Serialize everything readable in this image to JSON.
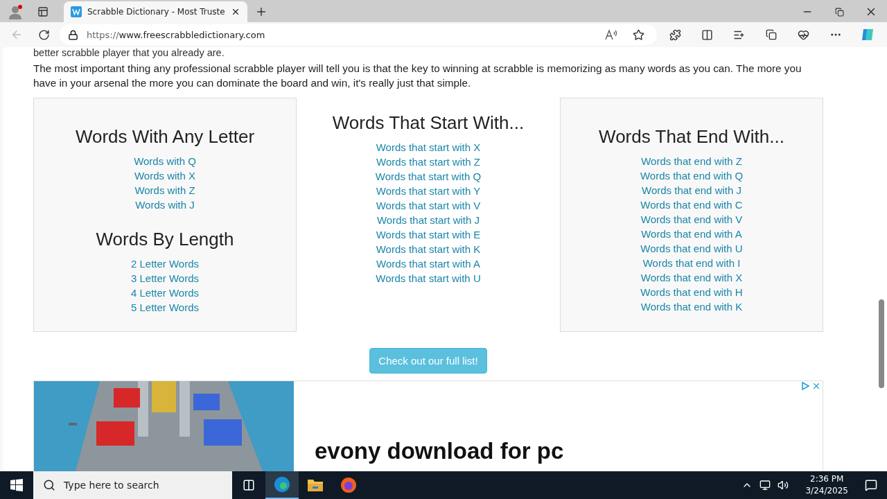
{
  "browser": {
    "tab_title": "Scrabble Dictionary - Most Truste",
    "url_prefix": "https://",
    "url_host": "www.freescrabbledictionary.com"
  },
  "page": {
    "intro_cut": "better scrabble player that you already are.",
    "paragraph": "The most important thing any professional scrabble player will tell you is that the key to winning at scrabble is memorizing as many words as you can. The more you have in your arsenal the more you can dominate the board and win, it's really just that simple.",
    "columns": [
      {
        "boxed": true,
        "sections": [
          {
            "heading": "Words With Any Letter",
            "links": [
              "Words with Q",
              "Words with X",
              "Words with Z",
              "Words with J"
            ]
          },
          {
            "heading": "Words By Length",
            "links": [
              "2 Letter Words",
              "3 Letter Words",
              "4 Letter Words",
              "5 Letter Words"
            ]
          }
        ]
      },
      {
        "boxed": false,
        "sections": [
          {
            "heading": "Words That Start With...",
            "links": [
              "Words that start with X",
              "Words that start with Z",
              "Words that start with Q",
              "Words that start with Y",
              "Words that start with V",
              "Words that start with J",
              "Words that start with E",
              "Words that start with K",
              "Words that start with A",
              "Words that start with U"
            ]
          }
        ]
      },
      {
        "boxed": true,
        "sections": [
          {
            "heading": "Words That End With...",
            "links": [
              "Words that end with Z",
              "Words that end with Q",
              "Words that end with J",
              "Words that end with C",
              "Words that end with V",
              "Words that end with A",
              "Words that end with U",
              "Words that end with I",
              "Words that end with X",
              "Words that end with H",
              "Words that end with K"
            ]
          }
        ]
      }
    ],
    "full_list_button": "Check out our full list!",
    "ad": {
      "headline": "evony download for pc"
    }
  },
  "taskbar": {
    "search_placeholder": "Type here to search",
    "time": "2:36 PM",
    "date": "3/24/2025"
  }
}
